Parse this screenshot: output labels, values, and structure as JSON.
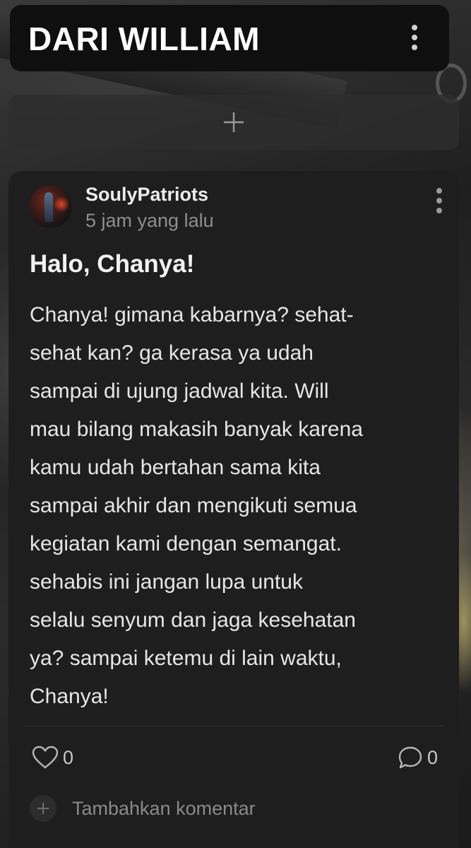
{
  "header": {
    "title": "DARI WILLIAM",
    "menu_icon": "more-vertical-icon"
  },
  "add_bar": {
    "icon": "plus-icon"
  },
  "post": {
    "author": "SoulyPatriots",
    "timestamp": "5 jam yang lalu",
    "menu_icon": "more-vertical-icon",
    "title": "Halo, Chanya!",
    "body_lines": [
      "Chanya! gimana kabarnya? sehat-",
      "sehat kan? ga kerasa ya udah",
      "sampai di ujung jadwal kita. Will",
      "mau bilang makasih banyak karena",
      "kamu udah bertahan sama kita",
      "sampai akhir dan mengikuti semua",
      "kegiatan kami dengan semangat.",
      "sehabis ini jangan lupa untuk",
      "selalu senyum dan jaga kesehatan",
      "ya? sampai ketemu di lain waktu,",
      "Chanya!"
    ],
    "likes": "0",
    "comments": "0",
    "add_comment_placeholder": "Tambahkan komentar"
  },
  "colors": {
    "header_bg": "#0f0f0f",
    "card_bg": "#1e1e1e",
    "text_primary": "#f2f2f2",
    "text_secondary": "#8e8e8e"
  }
}
